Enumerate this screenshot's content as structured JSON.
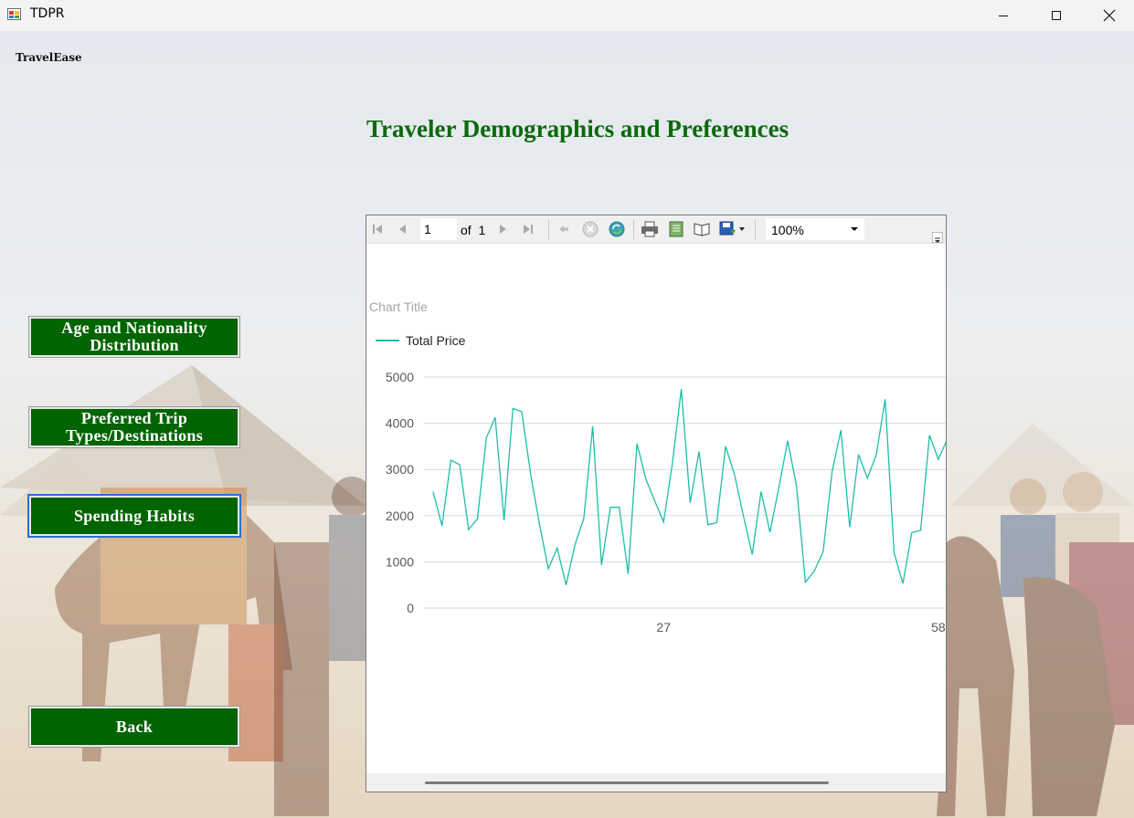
{
  "window": {
    "title": "TDPR",
    "controls": [
      "minimize",
      "maximize",
      "close"
    ]
  },
  "brand": "TravelEase",
  "heading": "Traveler Demographics and Preferences",
  "nav": {
    "age_button": "Age and Nationality Distribution",
    "age_line1": "Age and Nationality",
    "age_line2": "Distribution",
    "trip_button": "Preferred Trip Types/Destinations",
    "trip_line1": "Preferred Trip",
    "trip_line2": "Types/Destinations",
    "spending_button": "Spending Habits",
    "back_button": "Back"
  },
  "report_toolbar": {
    "current_page": "1",
    "of_label": "of",
    "total_pages": "1",
    "zoom": "100%",
    "icons": [
      "first-page-icon",
      "previous-page-icon",
      "next-page-icon",
      "last-page-icon",
      "back-icon",
      "stop-icon",
      "refresh-icon",
      "print-icon",
      "print-layout-icon",
      "page-setup-icon",
      "export-icon"
    ]
  },
  "colors": {
    "button_green": "#006400",
    "heading_green": "#0b6a0b",
    "series_color": "#1fbcaa"
  },
  "chart_data": {
    "type": "line",
    "title": "Chart Title",
    "legend_position": "top-left",
    "series": [
      {
        "name": "Total Price",
        "values": [
          2520,
          1780,
          3200,
          3100,
          1700,
          1930,
          3680,
          4130,
          1900,
          4320,
          4250,
          2900,
          1810,
          850,
          1300,
          500,
          1370,
          1940,
          3930,
          930,
          2180,
          2180,
          740,
          3560,
          2790,
          2320,
          1860,
          3140,
          4740,
          2280,
          3390,
          1800,
          1850,
          3500,
          2890,
          2000,
          1160,
          2520,
          1640,
          2600,
          3620,
          2640,
          560,
          800,
          1220,
          2940,
          3850,
          1750,
          3320,
          2810,
          3320,
          4520,
          1200,
          530,
          1630,
          1680,
          3740,
          3220,
          3650
        ]
      }
    ],
    "x_tick_labels": [
      "27",
      "58"
    ],
    "y_tick_labels": [
      "0",
      "1000",
      "2000",
      "3000",
      "4000",
      "5000"
    ],
    "ylim": [
      0,
      5000
    ],
    "grid": true
  }
}
